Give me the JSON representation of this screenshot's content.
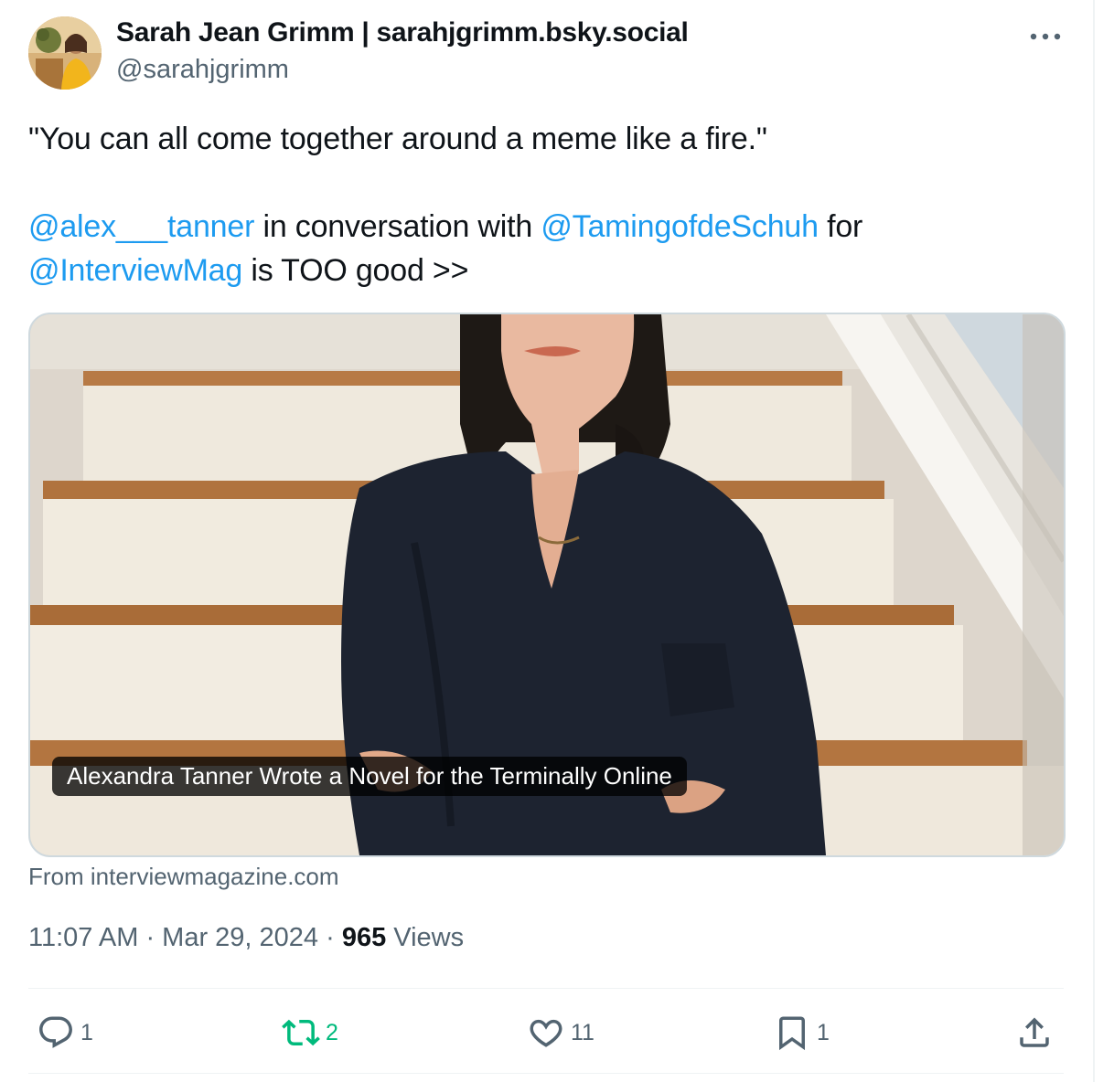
{
  "author": {
    "display_name": "Sarah Jean Grimm | sarahjgrimm.bsky.social",
    "handle": "@sarahjgrimm"
  },
  "tweet": {
    "quote": "\"You can all come together around a meme like a fire.\"",
    "mention_1": "@alex___tanner",
    "text_1": " in conversation with ",
    "mention_2": "@TamingofdeSchuh",
    "text_2": " for",
    "mention_3": "@InterviewMag",
    "text_3": " is TOO good >>"
  },
  "card": {
    "caption": "Alexandra Tanner Wrote a Novel for the Terminally Online",
    "source": "From interviewmagazine.com"
  },
  "meta": {
    "time": "11:07 AM",
    "separator": " · ",
    "date": "Mar 29, 2024",
    "views_count": "965",
    "views_label": " Views"
  },
  "actions": {
    "replies": "1",
    "retweets": "2",
    "likes": "11",
    "bookmarks": "1"
  },
  "icons": {
    "more": "more-horizontal-icon",
    "reply": "reply-bubble-icon",
    "retweet": "retweet-icon",
    "like": "heart-icon",
    "bookmark": "bookmark-icon",
    "share": "share-upload-icon"
  },
  "colors": {
    "link": "#1d9bf0",
    "secondary_text": "#536471",
    "retweet_active": "#00ba7c",
    "primary_text": "#0f1419"
  }
}
